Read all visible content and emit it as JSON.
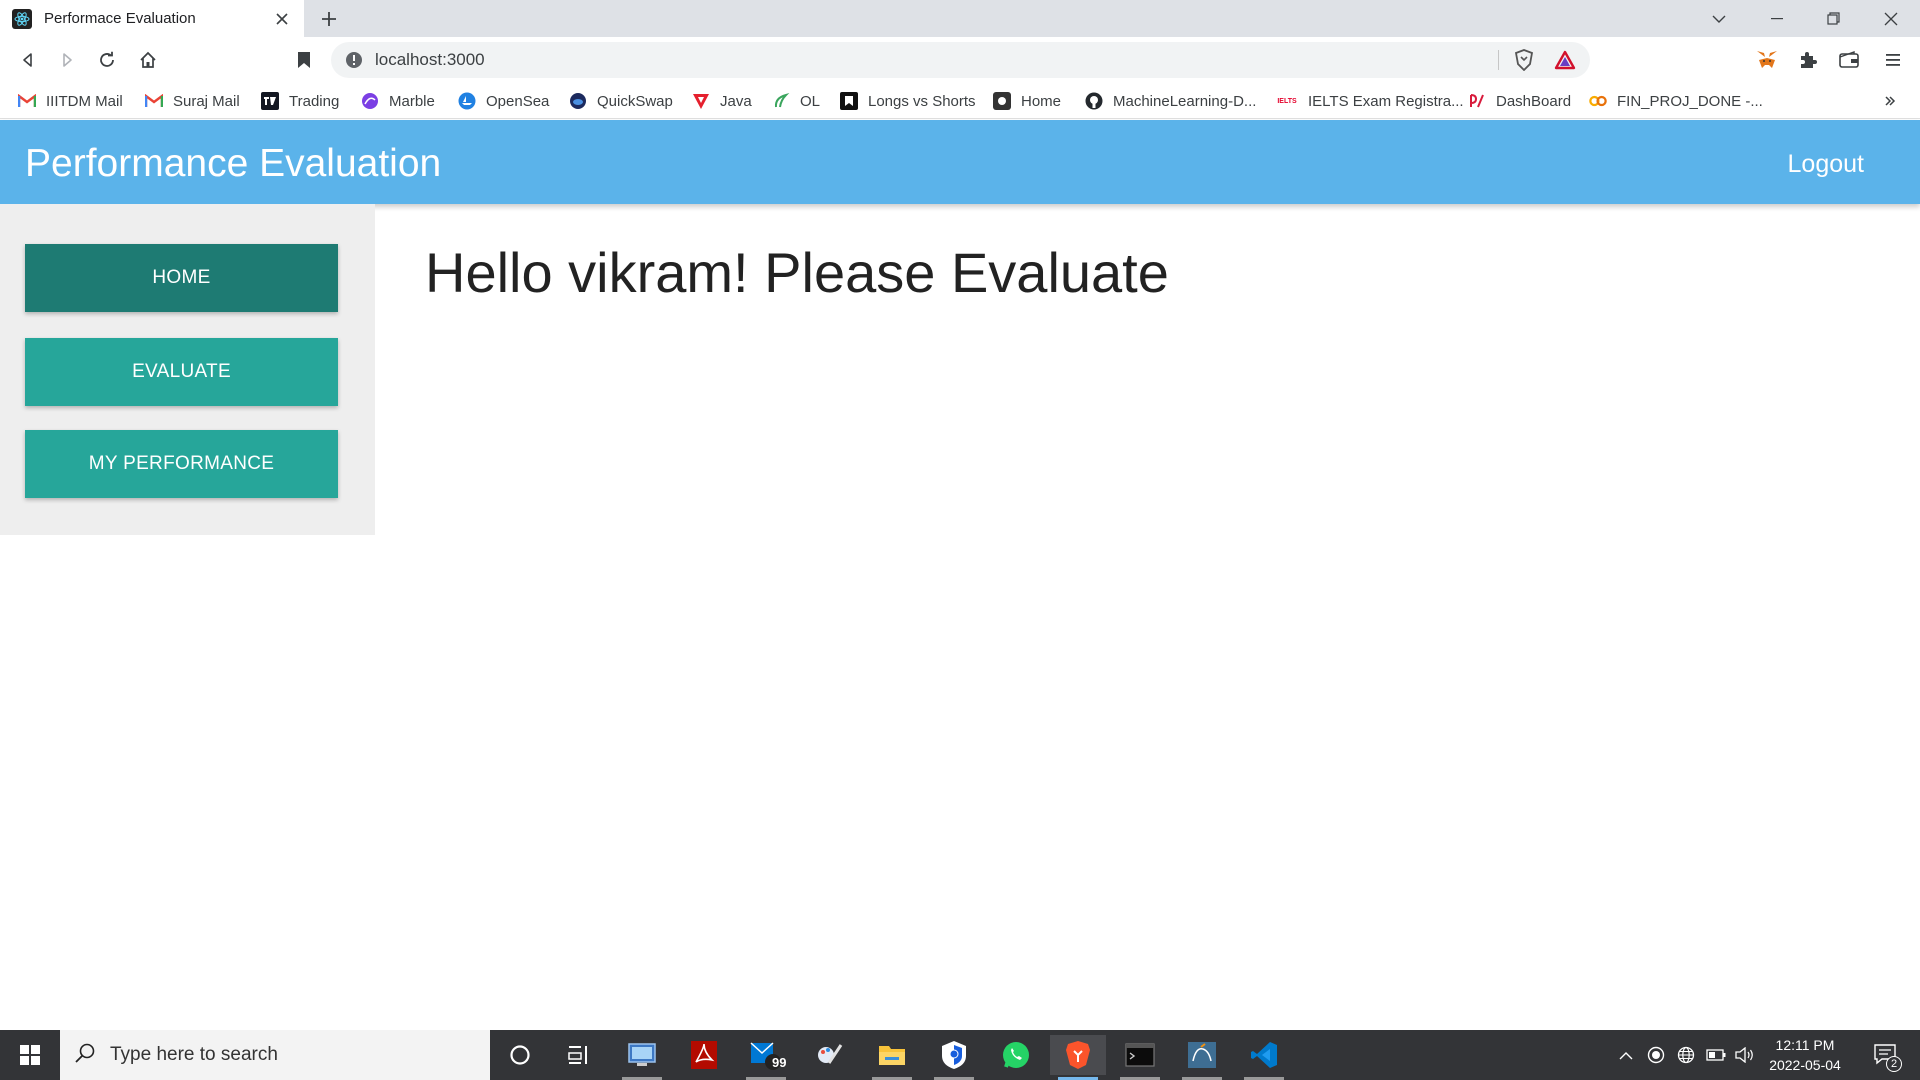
{
  "browser": {
    "tab_title": "Performace Evaluation",
    "url": "localhost:3000",
    "bookmarks": [
      {
        "label": "IIITDM Mail",
        "icon": "gmail-icon"
      },
      {
        "label": "Suraj Mail",
        "icon": "gmail-icon"
      },
      {
        "label": "Trading",
        "icon": "tradingview-icon"
      },
      {
        "label": "Marble",
        "icon": "marble-icon"
      },
      {
        "label": "OpenSea",
        "icon": "opensea-icon"
      },
      {
        "label": "QuickSwap",
        "icon": "quickswap-icon"
      },
      {
        "label": "Java",
        "icon": "java-icon"
      },
      {
        "label": "OL",
        "icon": "ol-icon"
      },
      {
        "label": "Longs vs Shorts",
        "icon": "longs-shorts-icon"
      },
      {
        "label": "Home",
        "icon": "home-site-icon"
      },
      {
        "label": "MachineLearning-D...",
        "icon": "github-icon"
      },
      {
        "label": "IELTS Exam Registra...",
        "icon": "ielts-icon"
      },
      {
        "label": "DashBoard",
        "icon": "dashboard-icon"
      },
      {
        "label": "FIN_PROJ_DONE -...",
        "icon": "colab-icon"
      }
    ],
    "ielts_badge": "IELTS"
  },
  "app": {
    "title": "Performance Evaluation",
    "logout_label": "Logout",
    "nav": [
      {
        "label": "HOME",
        "active": true
      },
      {
        "label": "EVALUATE",
        "active": false
      },
      {
        "label": "MY PERFORMANCE",
        "active": false
      }
    ],
    "greeting": "Hello vikram! Please Evaluate"
  },
  "taskbar": {
    "search_placeholder": "Type here to search",
    "mail_badge": "99",
    "time": "12:11 PM",
    "date": "2022-05-04",
    "notification_count": "2"
  },
  "colors": {
    "appbar": "#5bb3ea",
    "nav_button": "#26a69a",
    "nav_button_active": "#1e7b73",
    "sidebar": "#eeeeee"
  }
}
